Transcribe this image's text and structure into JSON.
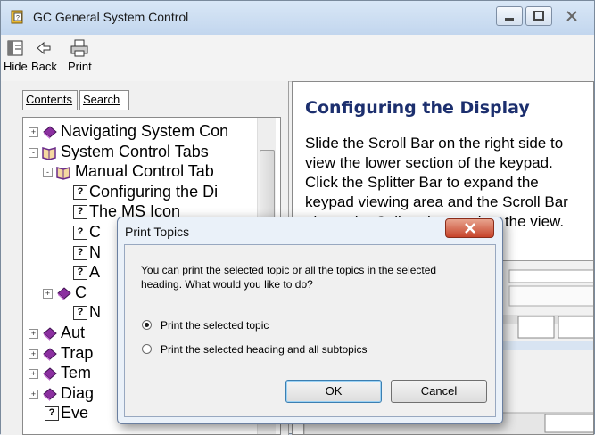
{
  "window": {
    "title": "GC General System Control"
  },
  "toolbar": {
    "hide": "Hide",
    "back": "Back",
    "print": "Print"
  },
  "tabs": {
    "contents": "Contents",
    "search": "Search"
  },
  "tree": [
    {
      "label": "Navigating System Con",
      "type": "book",
      "expand": "+"
    },
    {
      "label": "System Control Tabs",
      "type": "book-open",
      "expand": "-"
    },
    {
      "label": "Manual Control Tab",
      "type": "book-open",
      "expand": "-"
    },
    {
      "label": "Configuring the Di",
      "type": "page"
    },
    {
      "label": "The MS Icon",
      "type": "page"
    },
    {
      "label": "C",
      "type": "page"
    },
    {
      "label": "N",
      "type": "page"
    },
    {
      "label": "A",
      "type": "page"
    },
    {
      "label": "C",
      "type": "book",
      "expand": "+"
    },
    {
      "label": "N",
      "type": "page"
    },
    {
      "label": "Aut",
      "type": "book",
      "expand": "+"
    },
    {
      "label": "Trap",
      "type": "book",
      "expand": "+"
    },
    {
      "label": "Tem",
      "type": "book",
      "expand": "+"
    },
    {
      "label": "Diag",
      "type": "book",
      "expand": "+"
    },
    {
      "label": "Eve",
      "type": "page"
    }
  ],
  "topic": {
    "title": "Configuring the Display",
    "body": "Slide the Scroll Bar on the right side to view the lower section of the keypad. Click the Splitter Bar to expand the keypad viewing area and the Scroll Bar above the Splitter bar to view the view."
  },
  "dialog": {
    "title": "Print Topics",
    "message": "You can print the selected topic or all the topics in the selected heading. What would you like to do?",
    "option1": "Print the selected topic",
    "option2": "Print the selected heading and all subtopics",
    "ok": "OK",
    "cancel": "Cancel",
    "selected": 1
  },
  "colors": {
    "title_text": "#1c2f6e",
    "close_red": "#c7442b"
  }
}
